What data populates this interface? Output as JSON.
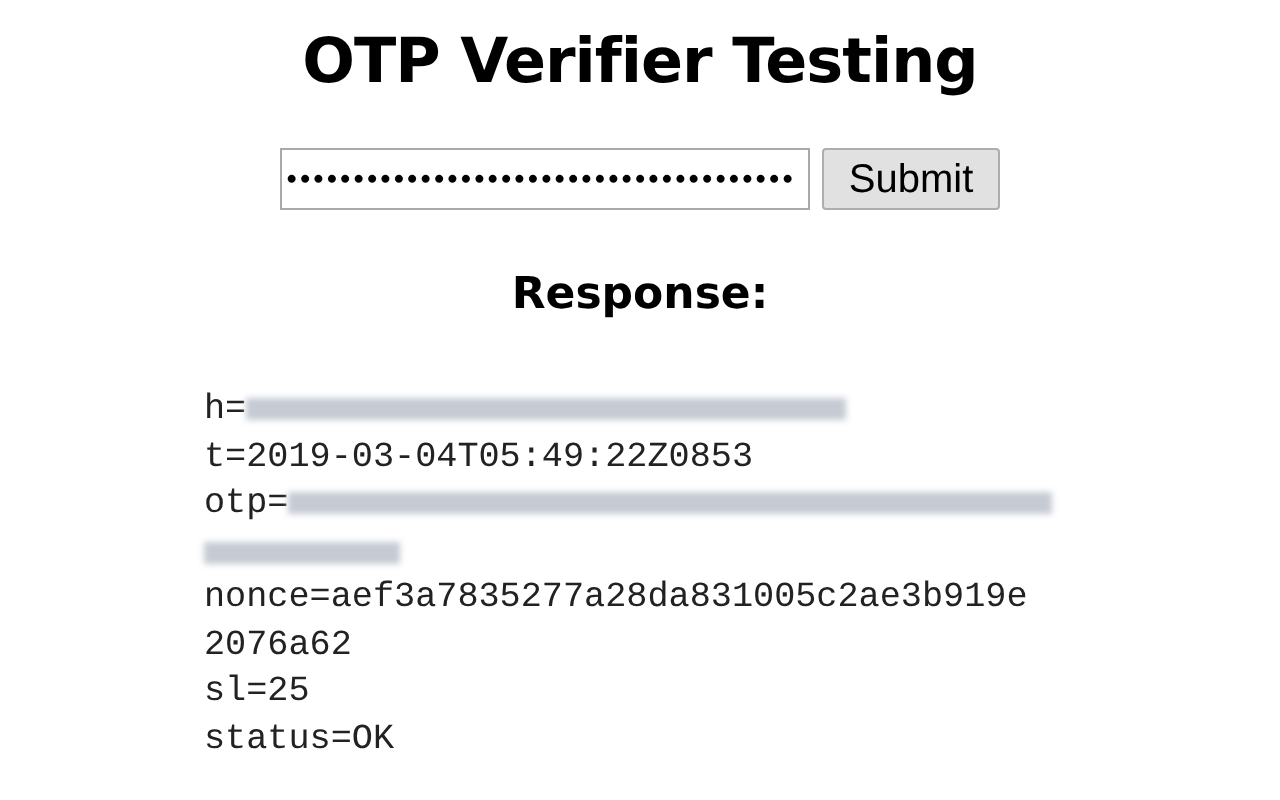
{
  "title": "OTP Verifier Testing",
  "otp_field": {
    "value": "••••••••••••••••••••••••••••••••••••••"
  },
  "submit_button": "Submit",
  "response_heading": "Response:",
  "response_lines": [
    {
      "key": "h=",
      "redacted": true,
      "kind": "short"
    },
    {
      "key": "t=2019-03-04T05:49:22Z0853",
      "redacted": false
    },
    {
      "key": "otp=",
      "redacted": true,
      "kind": "long"
    },
    {
      "key": "nonce=aef3a7835277a28da831005c2ae3b919e2076a62",
      "redacted": false
    },
    {
      "key": "sl=25",
      "redacted": false
    },
    {
      "key": "status=OK",
      "redacted": false
    }
  ]
}
